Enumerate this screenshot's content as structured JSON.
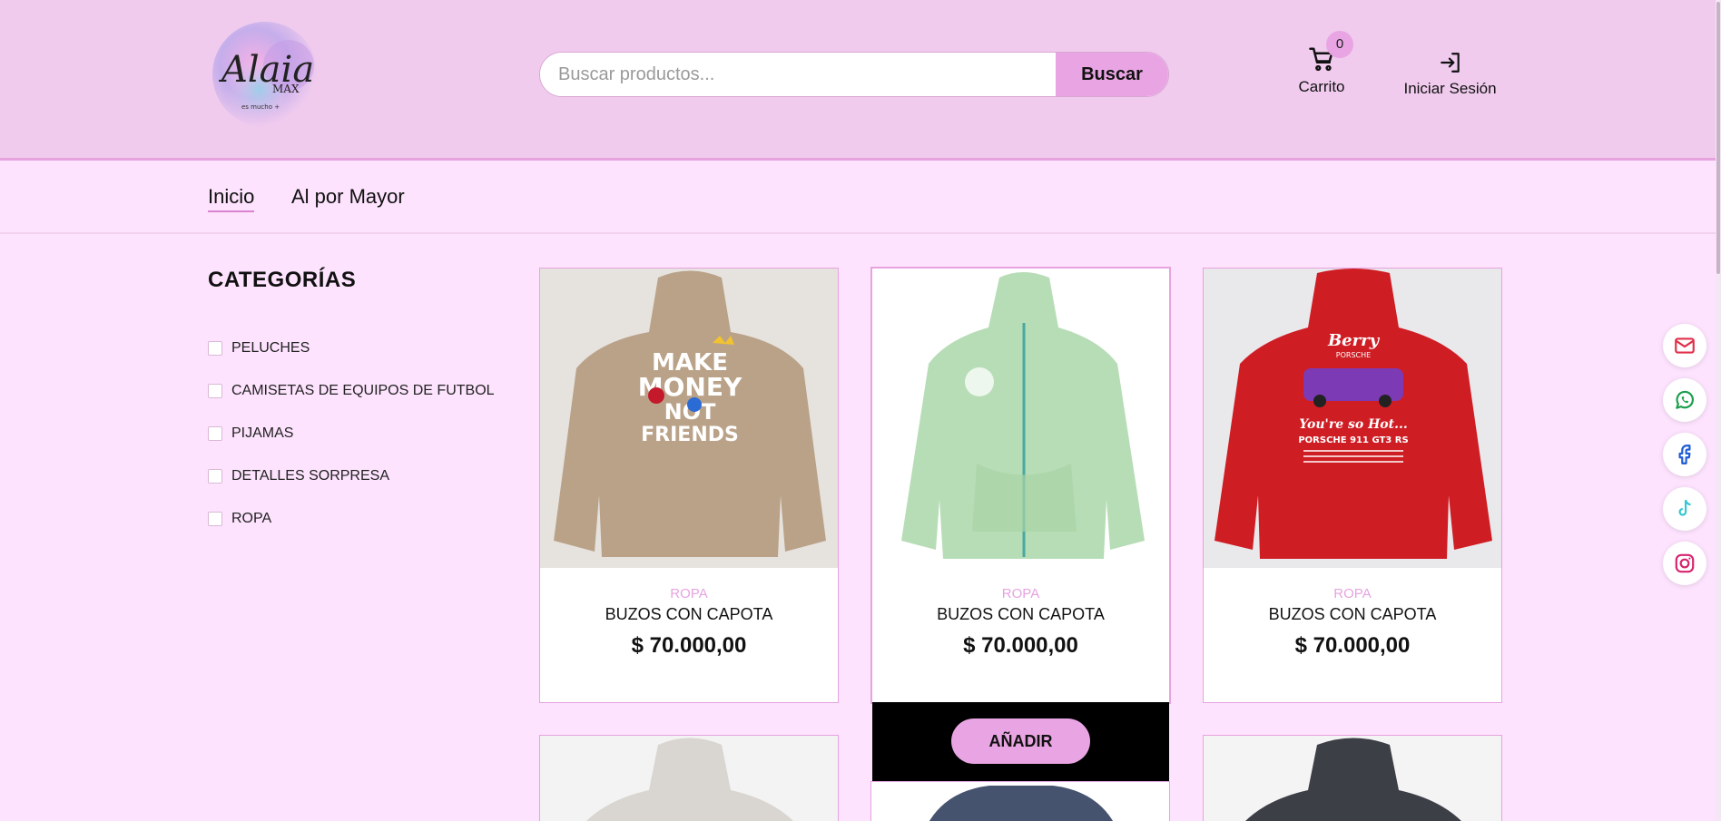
{
  "header": {
    "logo": {
      "text_main": "Alaia",
      "text_sub": "MAX",
      "text_tag": "es mucho +"
    },
    "search": {
      "placeholder": "Buscar productos...",
      "button_label": "Buscar"
    },
    "cart": {
      "count": "0",
      "label": "Carrito"
    },
    "login": {
      "label": "Iniciar Sesión"
    }
  },
  "nav": {
    "items": [
      {
        "label": "Inicio"
      },
      {
        "label": "Al por Mayor"
      }
    ]
  },
  "categories": {
    "title": "CATEGORÍAS",
    "items": [
      {
        "label": "PELUCHES"
      },
      {
        "label": "CAMISETAS DE EQUIPOS DE FUTBOL"
      },
      {
        "label": "PIJAMAS"
      },
      {
        "label": "DETALLES SORPRESA"
      },
      {
        "label": "ROPA"
      }
    ]
  },
  "products": [
    {
      "category": "ROPA",
      "name": "BUZOS CON CAPOTA",
      "price": "$ 70.000,00",
      "color": "#b9a288",
      "print_text": [
        "MAKE",
        "MONEY",
        "NOT",
        "FRIENDS"
      ]
    },
    {
      "category": "ROPA",
      "name": "BUZOS CON CAPOTA",
      "price": "$ 70.000,00",
      "color": "#b7ddb6"
    },
    {
      "category": "ROPA",
      "name": "BUZOS CON CAPOTA",
      "price": "$ 70.000,00",
      "color": "#cf1d24",
      "print_text": [
        "Berry",
        "PORSCHE",
        "You're so Hot...",
        "PORSCHE 911 GT3 RS"
      ]
    }
  ],
  "add_button_label": "AÑADIR",
  "second_row_colors": [
    "#d9d5d0",
    "#45536e",
    "#3d3f46"
  ],
  "social": [
    "mail-icon",
    "whatsapp-icon",
    "facebook-icon",
    "tiktok-icon",
    "instagram-icon"
  ],
  "colors": {
    "header_bg": "#f0cbee",
    "page_bg": "#fde3fd",
    "accent": "#e9a5e3"
  }
}
